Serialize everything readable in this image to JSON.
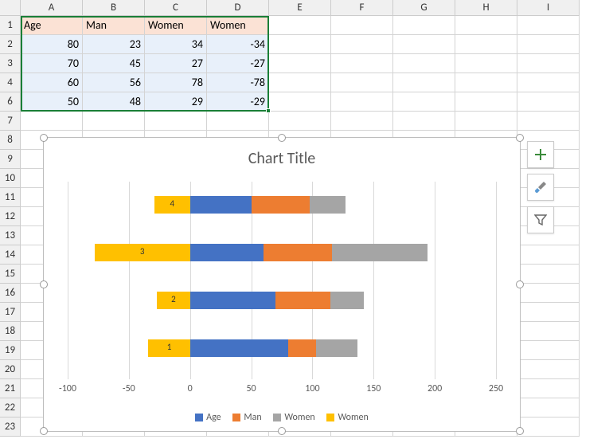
{
  "columns": [
    "A",
    "B",
    "C",
    "D",
    "E",
    "F",
    "G",
    "H",
    "I"
  ],
  "rows": [
    "1",
    "2",
    "3",
    "4",
    "6",
    "7",
    "8",
    "9",
    "10",
    "11",
    "12",
    "13",
    "14",
    "15",
    "16",
    "17",
    "18",
    "19",
    "20",
    "21",
    "22",
    "23"
  ],
  "table": {
    "headers": [
      "Age",
      "Man",
      "Women",
      "Women"
    ],
    "data": [
      [
        "80",
        "23",
        "34",
        "-34"
      ],
      [
        "70",
        "45",
        "27",
        "-27"
      ],
      [
        "60",
        "56",
        "78",
        "-78"
      ],
      [
        "50",
        "48",
        "29",
        "-29"
      ]
    ]
  },
  "chart": {
    "title": "Chart Title",
    "x_ticks": [
      "-100",
      "-50",
      "0",
      "50",
      "100",
      "150",
      "200",
      "250"
    ],
    "legend": [
      "Age",
      "Man",
      "Women",
      "Women"
    ],
    "colors": {
      "age": "#4472c4",
      "man": "#ed7d31",
      "women1": "#a5a5a5",
      "women2": "#ffc000"
    },
    "cat_labels": [
      "1",
      "2",
      "3",
      "4"
    ]
  },
  "chart_data": {
    "type": "bar",
    "title": "Chart Title",
    "orientation": "horizontal",
    "stacked": true,
    "categories": [
      "1",
      "2",
      "3",
      "4"
    ],
    "series": [
      {
        "name": "Age",
        "values": [
          80,
          70,
          60,
          50
        ],
        "color": "#4472c4"
      },
      {
        "name": "Man",
        "values": [
          23,
          45,
          56,
          48
        ],
        "color": "#ed7d31"
      },
      {
        "name": "Women",
        "values": [
          34,
          27,
          78,
          29
        ],
        "color": "#a5a5a5"
      },
      {
        "name": "Women",
        "values": [
          -34,
          -27,
          -78,
          -29
        ],
        "color": "#ffc000"
      }
    ],
    "xlabel": "",
    "ylabel": "",
    "xlim": [
      -100,
      250
    ],
    "x_ticks": [
      -100,
      -50,
      0,
      50,
      100,
      150,
      200,
      250
    ],
    "legend_position": "bottom"
  },
  "icons": {
    "plus": "chart-elements-button",
    "brush": "chart-styles-button",
    "filter": "chart-filters-button"
  }
}
